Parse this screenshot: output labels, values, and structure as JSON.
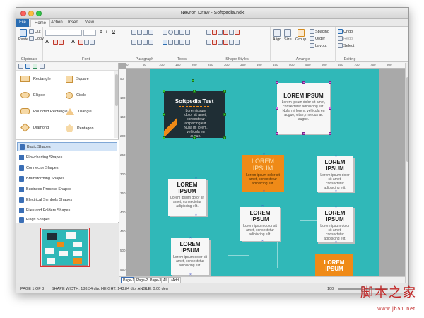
{
  "window": {
    "title": "Nevron Draw - Softpedia.ndx"
  },
  "tabs": [
    "File",
    "Home",
    "Action",
    "Insert",
    "View"
  ],
  "ribbon": {
    "clipboard": {
      "label": "Clipboard",
      "paste": "Paste",
      "cut": "Cut",
      "copy": "Copy"
    },
    "font": {
      "label": "Font",
      "bold": "B",
      "italic": "I",
      "underline": "U",
      "font_a": "A"
    },
    "paragraph": {
      "label": "Paragraph"
    },
    "tools": {
      "label": "Tools"
    },
    "shape_styles": {
      "label": "Shape Styles"
    },
    "arrange": {
      "label": "Arrange",
      "align": "Align",
      "size": "Size",
      "group": "Group",
      "spacing": "Spacing",
      "order": "Order",
      "layout": "Layout"
    },
    "editing": {
      "label": "Editing",
      "undo": "Undo",
      "redo": "Redo",
      "select": "Select"
    }
  },
  "shapes_panel": {
    "items": [
      {
        "label": "Rectangle"
      },
      {
        "label": "Square"
      },
      {
        "label": "Ellipse"
      },
      {
        "label": "Circle"
      },
      {
        "label": "Rounded Rectangle"
      },
      {
        "label": "Triangle"
      },
      {
        "label": "Diamond"
      },
      {
        "label": "Pentagon"
      }
    ]
  },
  "libraries": [
    {
      "label": "Basic Shapes"
    },
    {
      "label": "Flowcharting Shapes"
    },
    {
      "label": "Connector Shapes"
    },
    {
      "label": "Brainstorming Shapes"
    },
    {
      "label": "Business Process Shapes"
    },
    {
      "label": "Electrical Symbols Shapes"
    },
    {
      "label": "Files and Folders Shapes"
    },
    {
      "label": "Flags Shapes"
    }
  ],
  "rulers": {
    "h": [
      "0",
      "50",
      "100",
      "150",
      "200",
      "250",
      "300",
      "350",
      "400",
      "450",
      "500",
      "550",
      "600",
      "650",
      "700",
      "750",
      "800"
    ],
    "v": [
      "50",
      "100",
      "150",
      "200",
      "250",
      "300",
      "350",
      "400",
      "450",
      "500",
      "550"
    ]
  },
  "diagram": {
    "main": {
      "title": "Softpedia Test",
      "body": "Lorem ipsum dolor sit amet, consectetur adipiscing elit. Nulla mi lorem, vehicula eu augue."
    },
    "lorem_title": "LOREM IPSUM",
    "lorem_body": "Lorem ipsum dolor sit amet, consectetur adipiscing elit.",
    "lorem_body_long": "Lorem ipsum dolor sit amet, consectetur adipiscing elit. Nulla mi lorem, vehicula eu augue, vitae, rhoncus ac augue."
  },
  "page_tabs": [
    "Page-1",
    "Page-2",
    "Page-3",
    "All",
    "Add"
  ],
  "status": {
    "page": "PAGE 1 OF 3",
    "shape": "SHAPE WIDTH: 188.34 dip, HEIGHT: 143.84 dip, ANGLE: 0.00 deg",
    "zoom": "100"
  },
  "watermark": {
    "cn": "脚本之家",
    "url": "www.jb51.net"
  },
  "colors": {
    "canvas": "#30b8b8",
    "accent": "#2a6db2",
    "orange": "#ef8a17",
    "dark": "#1f2e35"
  }
}
